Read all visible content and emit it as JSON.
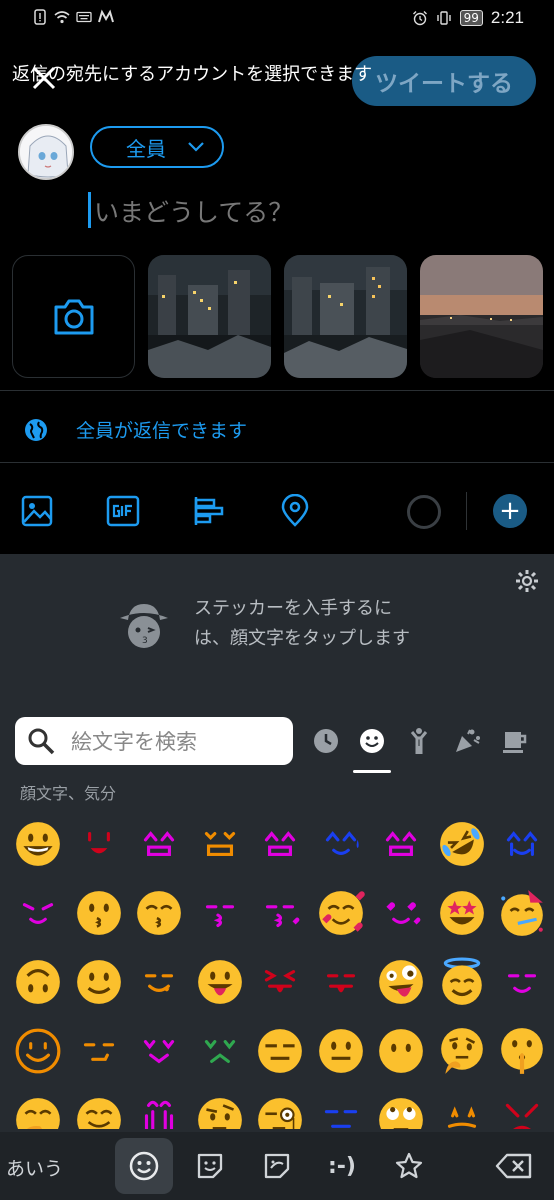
{
  "status_bar": {
    "time": "2:21",
    "battery": "99"
  },
  "compose": {
    "tooltip": "返信の宛先にするアカウントを選択できます",
    "tweet_button": "ツイートする",
    "audience": "全員",
    "placeholder": "いまどうしてる？",
    "reply_setting": "全員が返信できます"
  },
  "keyboard": {
    "sticker_promo_line1": "ステッカーを入手するに",
    "sticker_promo_line2": "は、顔文字をタップします",
    "search_placeholder": "絵文字を検索",
    "category_label": "顔文字、気分",
    "ime_label": "あいう",
    "emoticon_tab": ":-)",
    "colors": {
      "accent": "#1d9bf0",
      "background": "#262b30",
      "yellow": "#fbc02d",
      "magenta": "#e000e0",
      "red": "#d0021b",
      "blue": "#1a3ff0",
      "orange": "#f08c00"
    },
    "emoji_rows": [
      [
        "grinning",
        "kaomoji-red",
        "kaomoji-magenta",
        "kaomoji-orange",
        "kaomoji-magenta",
        "kaomoji-blue-sweat",
        "kaomoji-magenta",
        "rolling-laughing",
        "kaomoji-blue-cry"
      ],
      [
        "kaomoji-magenta-wink",
        "kissing",
        "kissing-smiling-eyes",
        "kaomoji-magenta-kiss",
        "kaomoji-magenta-kiss-heart",
        "smiling-hearts",
        "kaomoji-magenta-heart-eyes",
        "star-struck",
        "partying"
      ],
      [
        "upside-down",
        "slightly-smiling",
        "kaomoji-orange-yum",
        "tongue-out",
        "kaomoji-red-squint-tongue",
        "kaomoji-red-tongue",
        "zany",
        "halo",
        "kaomoji-magenta-smile"
      ],
      [
        "kaomoji-orange-smile",
        "kaomoji-orange-smirk",
        "kaomoji-magenta-grin",
        "kaomoji-green-frown",
        "expressionless",
        "neutral",
        "no-mouth",
        "thinking",
        "shushing"
      ],
      [
        "hand-over-mouth",
        "smiling-hands",
        "kaomoji-magenta-hands",
        "raised-eyebrow",
        "monocle",
        "kaomoji-blue-flat",
        "rolling-eyes",
        "kaomoji-orange-stars",
        "kaomoji-red-x"
      ]
    ]
  }
}
